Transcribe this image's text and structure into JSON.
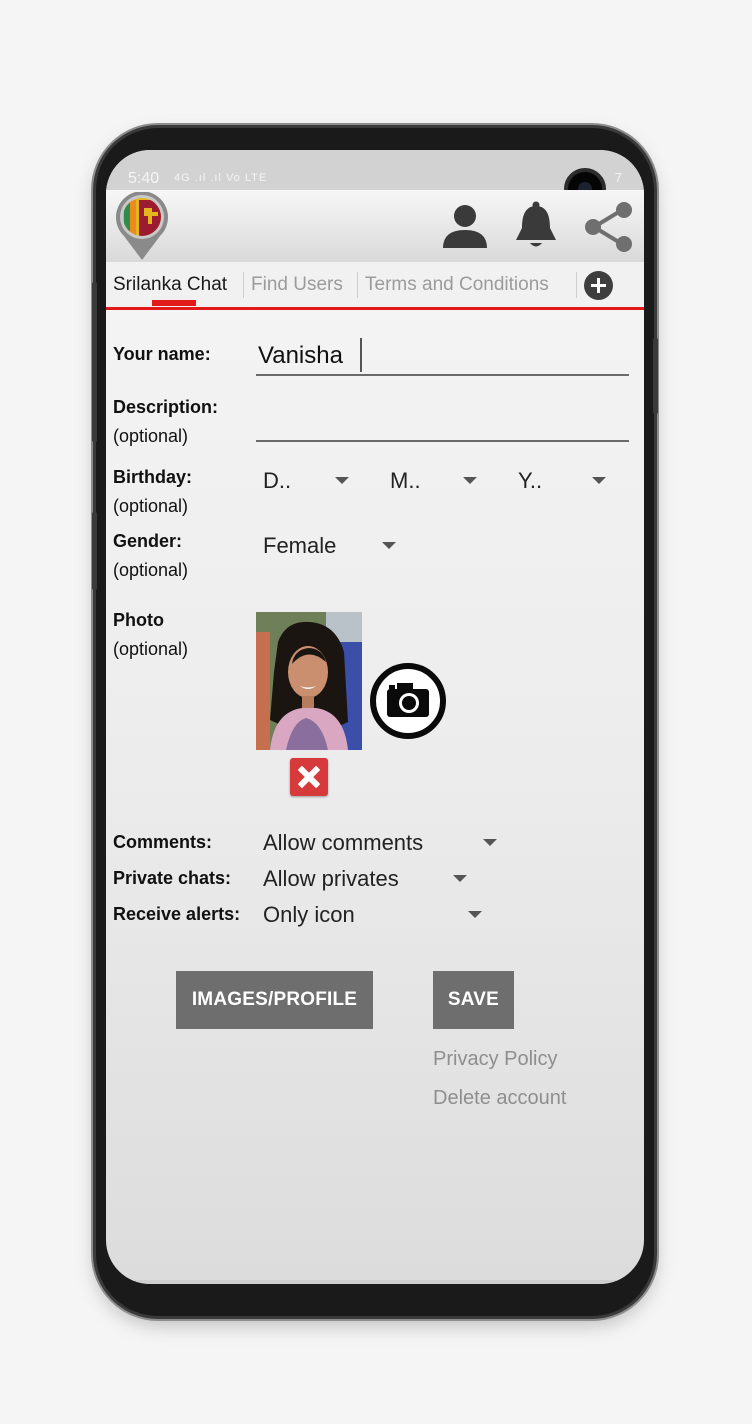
{
  "status_bar": {
    "time": "5:40",
    "network": "4G .ıl .ıl Vo LTE",
    "battery": "7"
  },
  "app_bar": {
    "logo_icon": "sri-lanka-map-pin-logo",
    "actions": [
      {
        "icon": "person-icon",
        "name": "profile"
      },
      {
        "icon": "bell-icon",
        "name": "notifications"
      },
      {
        "icon": "share-icon",
        "name": "share"
      }
    ]
  },
  "tabs": [
    {
      "label": "Srilanka Chat",
      "active": true
    },
    {
      "label": "Find Users",
      "active": false
    },
    {
      "label": "Terms and Conditions",
      "active": false
    }
  ],
  "add_tab_icon": "plus-circle-icon",
  "form": {
    "name": {
      "label": "Your name:",
      "value": "Vanisha"
    },
    "description": {
      "label": "Description:",
      "hint": "(optional)",
      "value": ""
    },
    "birthday": {
      "label": "Birthday:",
      "hint": "(optional)",
      "day": "D..",
      "month": "M..",
      "year": "Y.."
    },
    "gender": {
      "label": "Gender:",
      "hint": "(optional)",
      "value": "Female"
    },
    "photo": {
      "label": "Photo",
      "hint": "(optional)",
      "camera_icon": "camera-icon",
      "delete_icon": "close-icon"
    },
    "comments": {
      "label": "Comments:",
      "value": "Allow comments"
    },
    "private_chats": {
      "label": "Private chats:",
      "value": "Allow privates"
    },
    "receive_alerts": {
      "label": "Receive alerts:",
      "value": "Only icon"
    }
  },
  "buttons": {
    "images_profile": "IMAGES/PROFILE",
    "save": "SAVE"
  },
  "links": {
    "privacy_policy": "Privacy Policy",
    "delete_account": "Delete account"
  },
  "colors": {
    "accent_red": "#e31a1a",
    "button_gray": "#6e6e6e",
    "link_gray": "#8e8e8e"
  }
}
